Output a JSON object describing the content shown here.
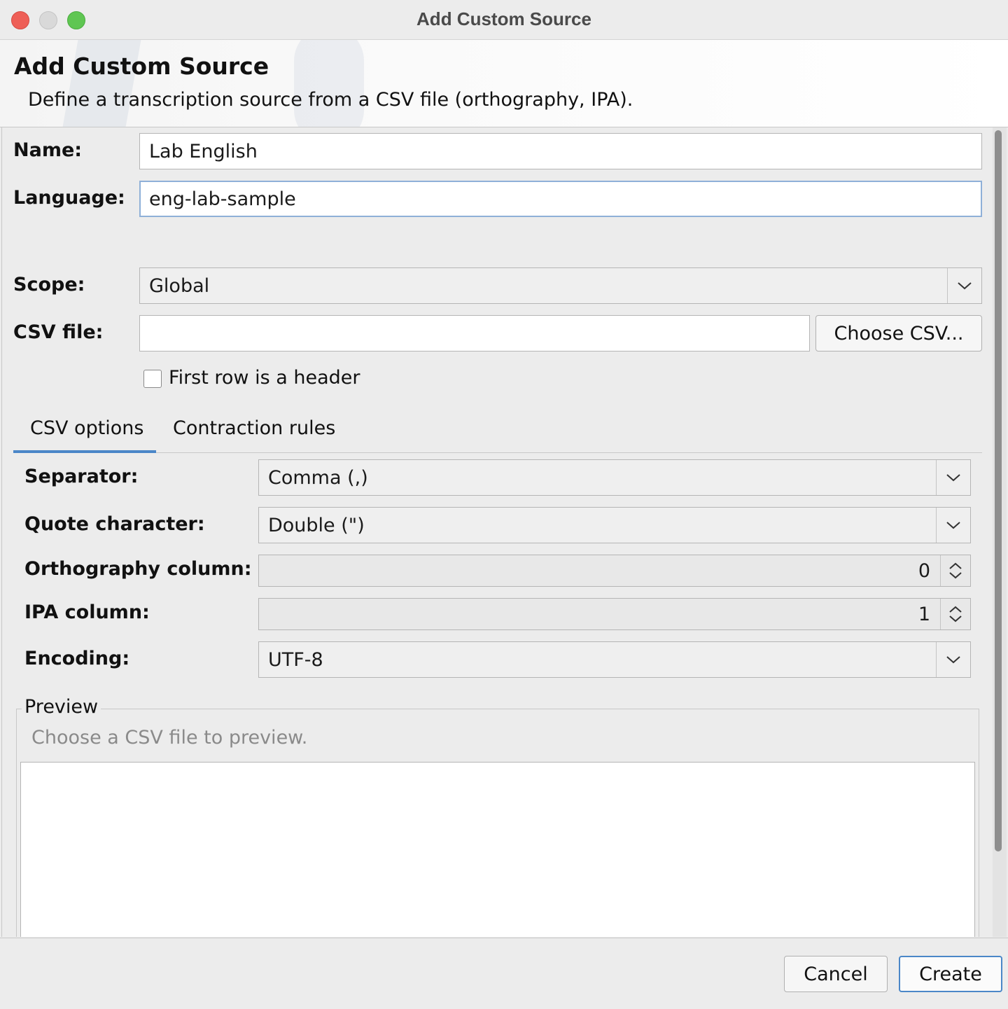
{
  "window": {
    "title": "Add Custom Source"
  },
  "banner": {
    "title": "Add Custom Source",
    "subtitle": "Define a transcription source from a CSV file (orthography, IPA)."
  },
  "form": {
    "name": {
      "label": "Name:",
      "value": "Lab English"
    },
    "language": {
      "label": "Language:",
      "value": "eng-lab-sample"
    },
    "scope": {
      "label": "Scope:",
      "value": "Global"
    },
    "csv_file": {
      "label": "CSV file:",
      "value": "",
      "button": "Choose CSV..."
    },
    "header_checkbox": {
      "label": "First row is a header",
      "checked": false
    }
  },
  "tabs": [
    {
      "label": "CSV options",
      "selected": true
    },
    {
      "label": "Contraction rules",
      "selected": false
    }
  ],
  "csv_options": {
    "separator": {
      "label": "Separator:",
      "value": "Comma (,)"
    },
    "quote": {
      "label": "Quote character:",
      "value": "Double (\")"
    },
    "orthography_column": {
      "label": "Orthography column:",
      "value": "0"
    },
    "ipa_column": {
      "label": "IPA column:",
      "value": "1"
    },
    "encoding": {
      "label": "Encoding:",
      "value": "UTF-8"
    }
  },
  "preview": {
    "legend": "Preview",
    "hint": "Choose a CSV file to preview."
  },
  "footer": {
    "cancel": "Cancel",
    "create": "Create"
  },
  "colors": {
    "accent": "#4b87c8",
    "close": "#ee5f57",
    "maximize": "#5fc652"
  }
}
